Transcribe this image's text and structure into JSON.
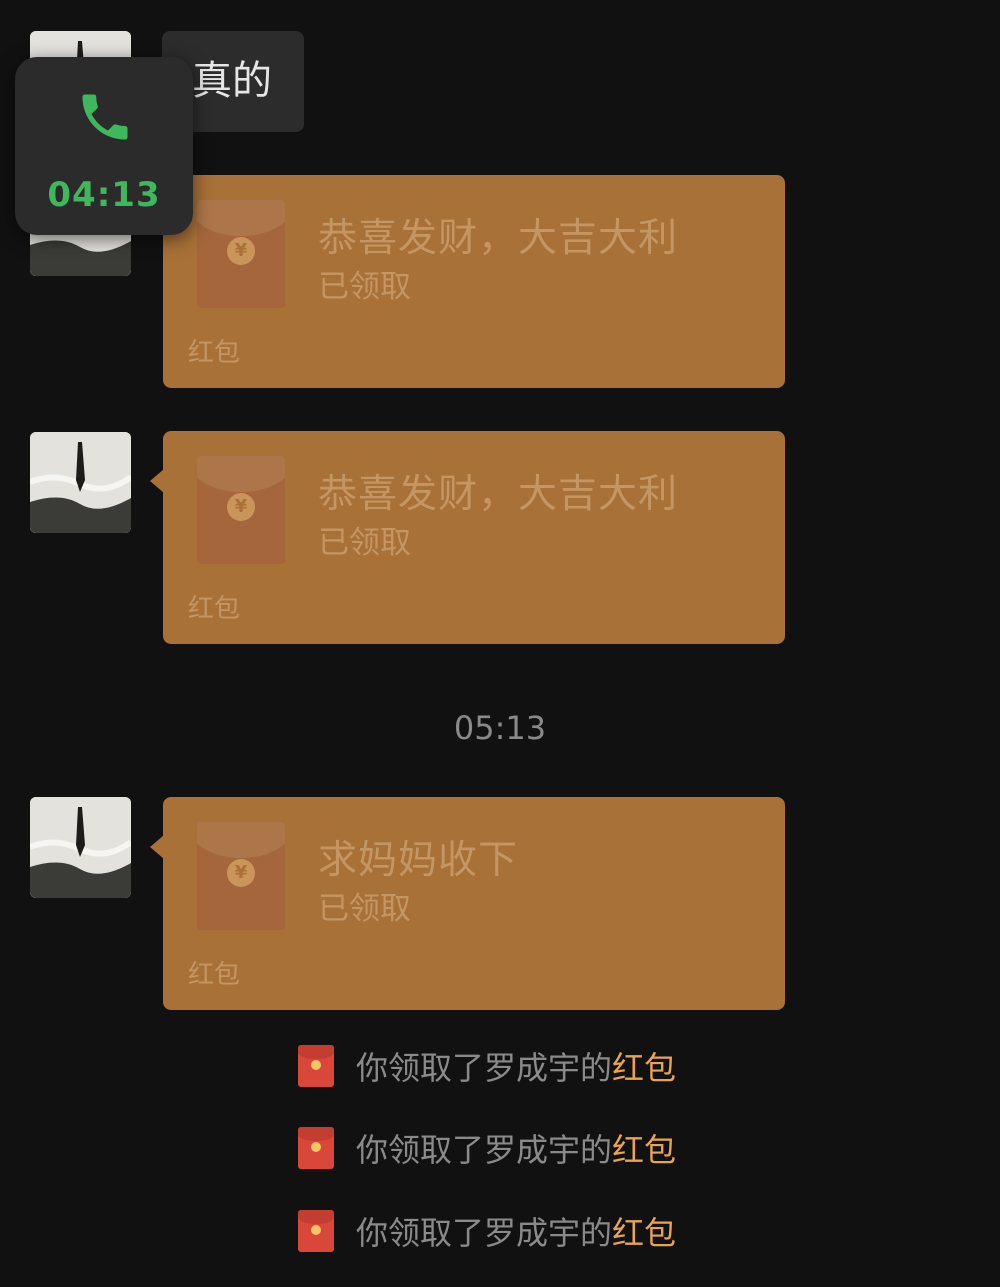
{
  "messages": {
    "text_message": "真的",
    "packets": [
      {
        "title": "恭喜发财，大吉大利",
        "status": "已领取",
        "footer": "红包"
      },
      {
        "title": "恭喜发财，大吉大利",
        "status": "已领取",
        "footer": "红包"
      },
      {
        "title": "求妈妈收下",
        "status": "已领取",
        "footer": "红包"
      }
    ],
    "timestamp": "05:13",
    "system_notices": [
      {
        "text": "你领取了罗成宇的",
        "link": "红包"
      },
      {
        "text": "你领取了罗成宇的",
        "link": "红包"
      },
      {
        "text": "你领取了罗成宇的",
        "link": "红包"
      }
    ]
  },
  "call_float": {
    "duration": "04:13",
    "icon": "phone-icon"
  },
  "colors": {
    "background": "#111111",
    "packet": "#a77137",
    "packet_text": "#c39663",
    "call_green": "#3fb75c",
    "link_orange": "#e8a453",
    "red_packet_icon": "#d8473a"
  }
}
